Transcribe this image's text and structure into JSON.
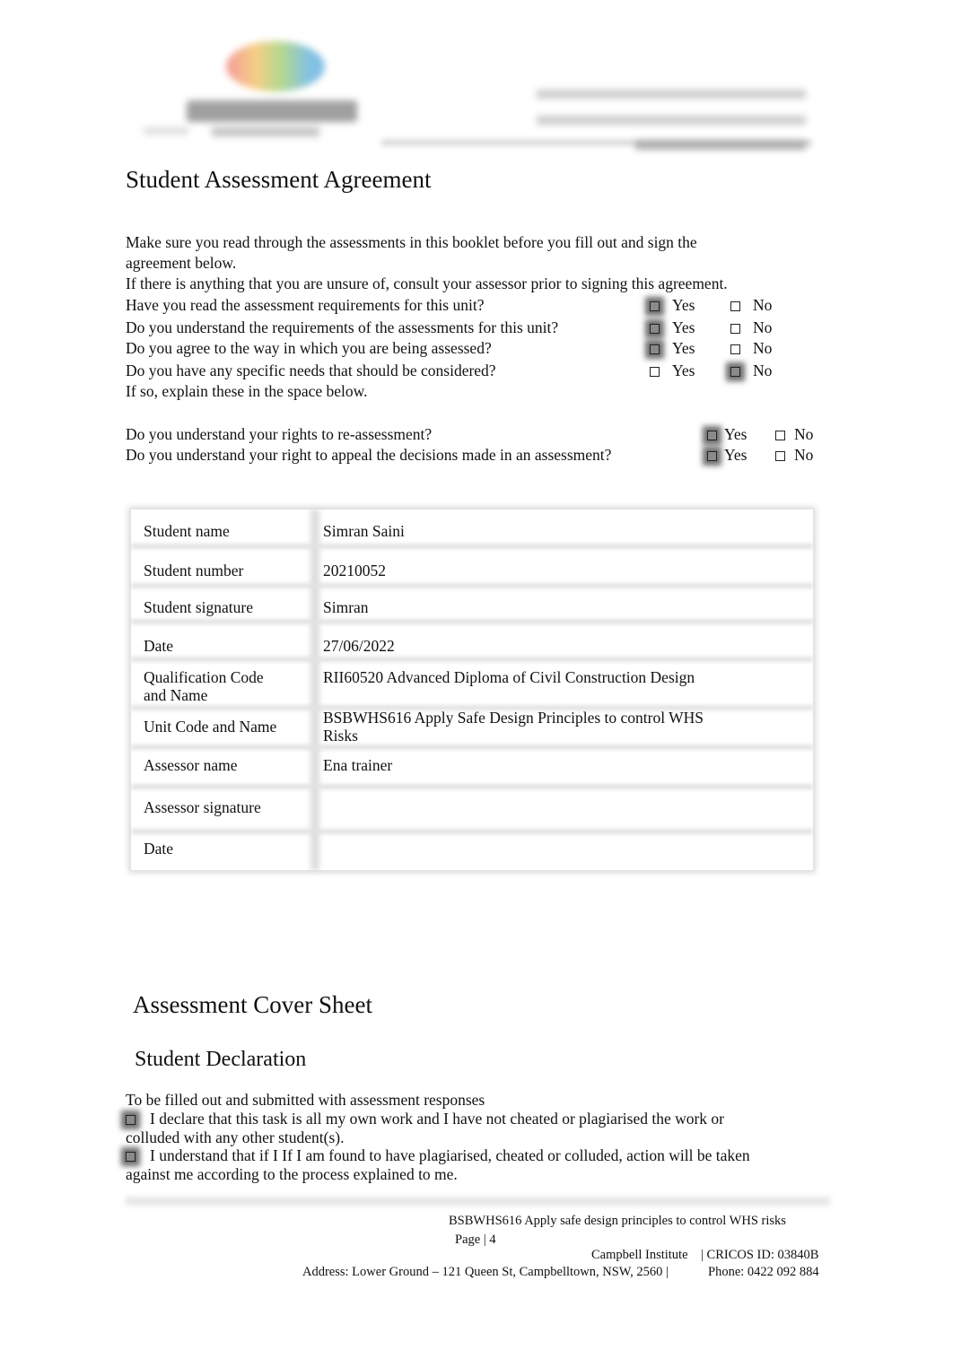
{
  "header": {
    "logo_text": "CAMPBELL",
    "letterhead_blurred": true
  },
  "agreement": {
    "title": "Student Assessment Agreement",
    "intro_line1": "Make sure you read through the assessments in this booklet before you fill out and sign the",
    "intro_line2": "agreement below.",
    "intro_line3": "If there is anything that you are unsure of, consult your assessor prior to signing this agreement.",
    "questions": [
      {
        "text": "Have you read the assessment requirements for this unit?",
        "yes_label": "Yes",
        "no_label": "No",
        "answer": "Yes"
      },
      {
        "text": "Do you understand the requirements of the assessments for this unit?",
        "yes_label": "Yes",
        "no_label": "No",
        "answer": "Yes"
      },
      {
        "text": "Do you agree to the way in which you are being assessed?",
        "yes_label": "Yes",
        "no_label": "No",
        "answer": "Yes"
      },
      {
        "text": "Do you have any specific needs that should be considered?",
        "yes_label": "Yes",
        "no_label": "No",
        "answer": "No"
      }
    ],
    "explain_note": "If so, explain these in the space below.",
    "rights_questions": [
      {
        "text": "Do you understand your rights to re-assessment?",
        "yes_label": "Yes",
        "no_label": "No",
        "answer": "Yes"
      },
      {
        "text": "Do you understand your right to appeal the decisions made in an assessment?",
        "yes_label": "Yes",
        "no_label": "No",
        "answer": "Yes"
      }
    ]
  },
  "details_table": {
    "rows": [
      {
        "label": "Student name",
        "value": "Simran Saini"
      },
      {
        "label": "Student number",
        "value": "20210052"
      },
      {
        "label": "Student signature",
        "value": "Simran"
      },
      {
        "label": "Date",
        "value": "27/06/2022"
      },
      {
        "label_line1": "Qualification Code",
        "label_line2": "and Name",
        "value": "RII60520 Advanced Diploma of Civil Construction Design"
      },
      {
        "label": "Unit Code and Name",
        "value_line1": "BSBWHS616 Apply Safe Design Principles to control WHS",
        "value_line2": "Risks"
      },
      {
        "label": "Assessor name",
        "value": "Ena trainer"
      },
      {
        "label": "Assessor signature",
        "value": ""
      },
      {
        "label": "Date",
        "value": ""
      }
    ]
  },
  "cover_sheet": {
    "title": "Assessment Cover Sheet",
    "subtitle": "Student Declaration",
    "instruction": "To be filled out and submitted with assessment responses",
    "declarations": [
      {
        "line1": "I declare that this task is all my own work and I have not cheated or plagiarised the work or",
        "line2": "colluded with any other student(s).",
        "checked": true
      },
      {
        "line1": "I understand that if I If I am found to have plagiarised, cheated or colluded, action will be taken",
        "line2": "against me according to the process explained to me.",
        "checked": true
      }
    ]
  },
  "footer": {
    "unit_title": "BSBWHS616 Apply safe design principles to control WHS risks",
    "page_label": "Page | 4",
    "institute": "Campbell Institute",
    "cricos": "|  CRICOS ID: 03840B",
    "address": "Address: Lower Ground – 121 Queen St, Campbelltown, NSW, 2560 |",
    "phone": "Phone: 0422 092 884"
  }
}
